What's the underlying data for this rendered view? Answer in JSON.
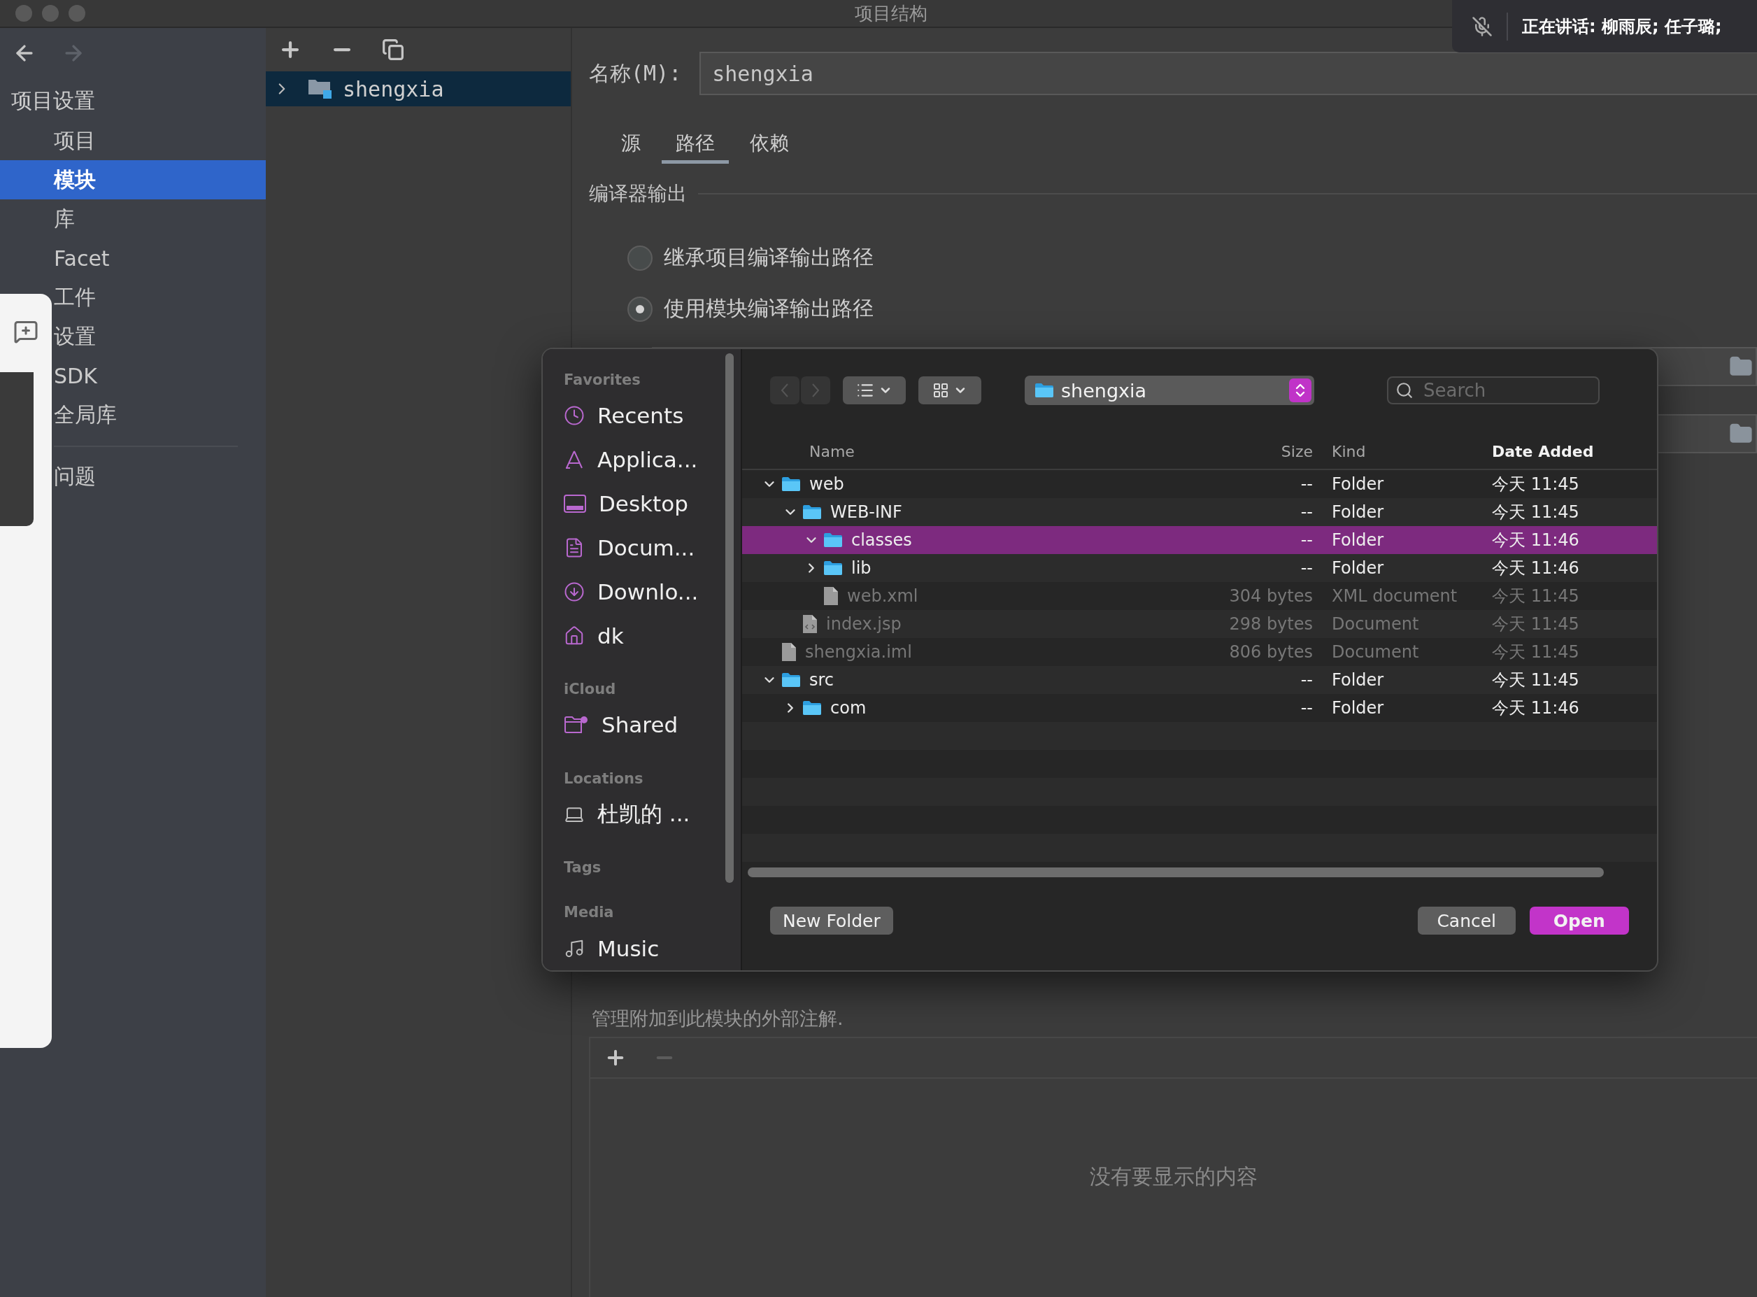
{
  "window": {
    "title": "项目结构"
  },
  "nav": [
    {
      "kind": "back",
      "disabled": false
    },
    {
      "kind": "forward",
      "disabled": true
    }
  ],
  "sidebar": {
    "title": "项目设置",
    "items": [
      {
        "label": "项目",
        "selected": false
      },
      {
        "label": "模块",
        "selected": true
      },
      {
        "label": "库",
        "selected": false
      },
      {
        "label": "Facet",
        "selected": false
      },
      {
        "label": "工件",
        "selected": false
      },
      {
        "label": "设置",
        "selected": false
      },
      {
        "label": "SDK",
        "selected": false
      },
      {
        "label": "全局库",
        "selected": false
      }
    ],
    "footer_items": [
      {
        "label": "问题",
        "selected": false
      }
    ]
  },
  "module_tree": [
    {
      "label": "shengxia",
      "expanded": false,
      "selected": true
    }
  ],
  "name_field": {
    "label": "名称(M):",
    "value": "shengxia"
  },
  "tabs": [
    {
      "label": "源",
      "selected": false
    },
    {
      "label": "路径",
      "selected": true
    },
    {
      "label": "依赖",
      "selected": false
    }
  ],
  "compiler_output": {
    "title": "编译器输出",
    "options": [
      {
        "label": "继承项目编译输出路径",
        "selected": false
      },
      {
        "label": "使用模块编译输出路径",
        "selected": true
      }
    ]
  },
  "external_annotations": {
    "description": "管理附加到此模块的外部注解.",
    "empty_text": "没有要显示的内容"
  },
  "meeting_banner": {
    "text": "正在讲话: 柳雨辰; 任子璐;"
  },
  "dialog": {
    "sidebar": [
      {
        "title": "Favorites",
        "items": [
          {
            "label": "Recents",
            "kind": "clock"
          },
          {
            "label": "Applica...",
            "kind": "apps"
          },
          {
            "label": "Desktop",
            "kind": "desktop"
          },
          {
            "label": "Docum...",
            "kind": "document"
          },
          {
            "label": "Downlo...",
            "kind": "download"
          },
          {
            "label": "dk",
            "kind": "home"
          }
        ]
      },
      {
        "title": "iCloud",
        "items": [
          {
            "label": "Shared",
            "kind": "shared"
          }
        ]
      },
      {
        "title": "Locations",
        "items": [
          {
            "label": "杜凯的 ...",
            "kind": "laptop"
          }
        ]
      },
      {
        "title": "Tags"
      },
      {
        "title": "Media",
        "items": [
          {
            "label": "Music",
            "kind": "music"
          }
        ]
      }
    ],
    "nav": [
      {
        "kind": "back",
        "disabled": true
      },
      {
        "kind": "forward",
        "disabled": true
      }
    ],
    "location": "shengxia",
    "search": {
      "placeholder": "Search"
    },
    "columns": [
      {
        "label": "Name",
        "sorted": false
      },
      {
        "label": "Size",
        "sorted": false
      },
      {
        "label": "Kind",
        "sorted": false
      },
      {
        "label": "Date Added",
        "sorted": true
      }
    ],
    "rows": [
      {
        "name": "web",
        "size": "--",
        "kind_label": "Folder",
        "date_added": "今天 11:45",
        "kind": "folder",
        "expanded": true,
        "selected": false,
        "disabled": false,
        "children": [
          {
            "name": "WEB-INF",
            "size": "--",
            "kind_label": "Folder",
            "date_added": "今天 11:45",
            "kind": "folder",
            "expanded": true,
            "selected": false,
            "disabled": false,
            "children": [
              {
                "name": "classes",
                "size": "--",
                "kind_label": "Folder",
                "date_added": "今天 11:46",
                "kind": "folder",
                "expanded": true,
                "selected": true,
                "disabled": false
              },
              {
                "name": "lib",
                "size": "--",
                "kind_label": "Folder",
                "date_added": "今天 11:46",
                "kind": "folder",
                "expanded": false,
                "selected": false,
                "disabled": false
              },
              {
                "name": "web.xml",
                "size": "304 bytes",
                "kind_label": "XML document",
                "date_added": "今天 11:45",
                "kind": "file",
                "selected": false,
                "disabled": true
              }
            ]
          },
          {
            "name": "index.jsp",
            "size": "298 bytes",
            "kind_label": "Document",
            "date_added": "今天 11:45",
            "kind": "code",
            "selected": false,
            "disabled": true
          }
        ]
      },
      {
        "name": "shengxia.iml",
        "size": "806 bytes",
        "kind_label": "Document",
        "date_added": "今天 11:45",
        "kind": "file",
        "selected": false,
        "disabled": true
      },
      {
        "name": "src",
        "size": "--",
        "kind_label": "Folder",
        "date_added": "今天 11:45",
        "kind": "folder",
        "expanded": true,
        "selected": false,
        "disabled": false,
        "children": [
          {
            "name": "com",
            "size": "--",
            "kind_label": "Folder",
            "date_added": "今天 11:46",
            "kind": "folder",
            "expanded": false,
            "selected": false,
            "disabled": false
          }
        ]
      }
    ],
    "buttons": [
      {
        "label": "New Folder",
        "kind": "default"
      },
      {
        "label": "Cancel",
        "kind": "default"
      },
      {
        "label": "Open",
        "kind": "primary"
      }
    ]
  }
}
